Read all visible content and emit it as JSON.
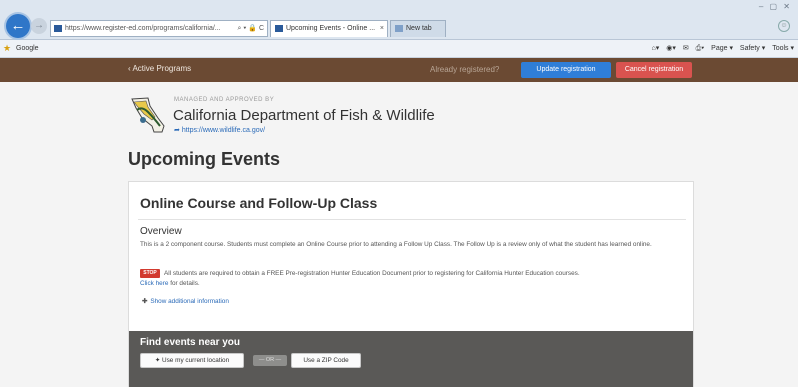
{
  "browser": {
    "address": "https://www.register-ed.com/programs/california/...",
    "address_domain_hint": "register-ed.com",
    "address_tools": "⌕ ▾ 🔒 C",
    "tabs": [
      {
        "label": "Upcoming Events - Online ...",
        "close": "×"
      },
      {
        "label": "New tab"
      }
    ],
    "window_controls": "– ▢ ✕",
    "favorites_label": "Google",
    "command_items": [
      "Page ▾",
      "Safety ▾",
      "Tools ▾"
    ]
  },
  "site_header": {
    "back_link": "‹ Active Programs",
    "already_registered": "Already registered?",
    "update_label": "Update registration",
    "cancel_label": "Cancel registration",
    "brand_brown": "#6b4a33",
    "update_color": "#2f7ed8",
    "cancel_color": "#d9534f"
  },
  "org": {
    "managed_by": "MANAGED AND APPROVED BY",
    "name": "California Department of Fish & Wildlife",
    "url": "https://www.wildlife.ca.gov/"
  },
  "page": {
    "title": "Upcoming Events"
  },
  "course": {
    "title": "Online Course and Follow-Up Class",
    "overview_title": "Overview",
    "description": "This is a 2 component course. Students must complete an Online Course prior to attending a Follow Up Class. The Follow Up is a review only of what the student has learned online.",
    "stop_badge": "STOP",
    "stop_text": "All students are required to obtain a FREE Pre-registration Hunter Education Document prior to registering for California Hunter Education courses.",
    "click_here": "Click here",
    "for_details": "for details.",
    "show_more": "Show additional information"
  },
  "find_events": {
    "title": "Find events near you",
    "use_location": "Use my current location",
    "or_label": "— OR —",
    "zip_label": "Use a ZIP Code"
  }
}
